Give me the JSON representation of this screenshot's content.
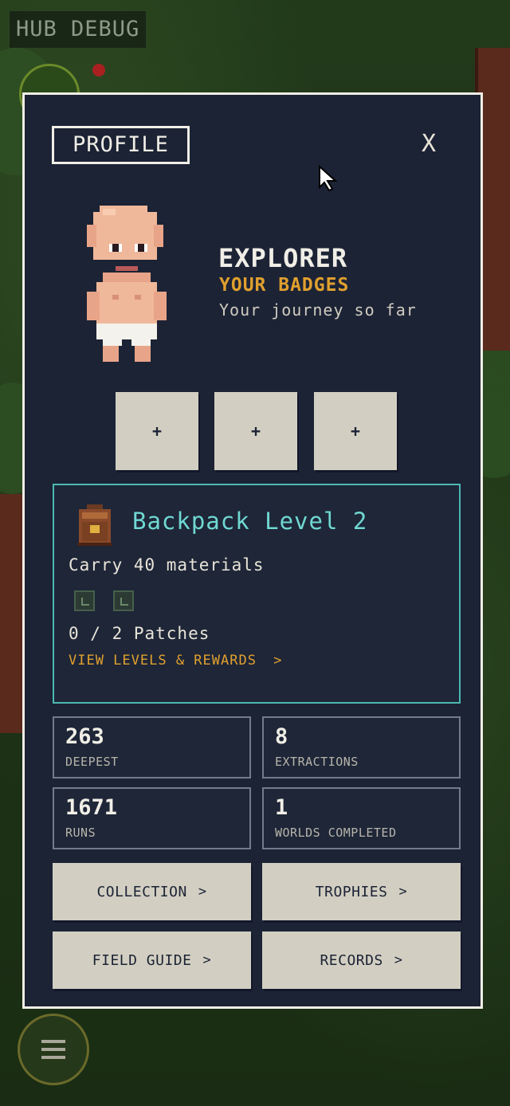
{
  "hud": {
    "debug_label": "HUB DEBUG"
  },
  "profile": {
    "tag_label": "PROFILE",
    "close_label": "X",
    "name": "EXPLORER",
    "badges_title": "YOUR BADGES",
    "subtitle": "Your journey so far",
    "badge_slots": [
      "+",
      "+",
      "+"
    ]
  },
  "backpack": {
    "title": "Backpack Level 2",
    "carry_text": "Carry 40 materials",
    "patches_text": "0 / 2 Patches",
    "link_label": "VIEW LEVELS & REWARDS",
    "link_chevron": ">"
  },
  "stats": [
    {
      "value": "263",
      "label": "DEEPEST"
    },
    {
      "value": "8",
      "label": "EXTRACTIONS"
    },
    {
      "value": "1671",
      "label": "RUNS"
    },
    {
      "value": "1",
      "label": "WORLDS COMPLETED"
    }
  ],
  "nav_buttons": [
    {
      "label": "COLLECTION",
      "chevron": ">"
    },
    {
      "label": "TROPHIES",
      "chevron": ">"
    },
    {
      "label": "FIELD GUIDE",
      "chevron": ">"
    },
    {
      "label": "RECORDS",
      "chevron": ">"
    }
  ],
  "colors": {
    "panel_bg": "#1c2335",
    "accent_teal": "#70d8d2",
    "accent_gold": "#e0a02e",
    "button_bg": "#d2cfc2"
  },
  "icons": {
    "close": "close-icon",
    "backpack": "backpack-icon",
    "patch": "patch-icon",
    "menu": "hamburger-menu-icon",
    "cursor": "mouse-cursor-icon"
  }
}
